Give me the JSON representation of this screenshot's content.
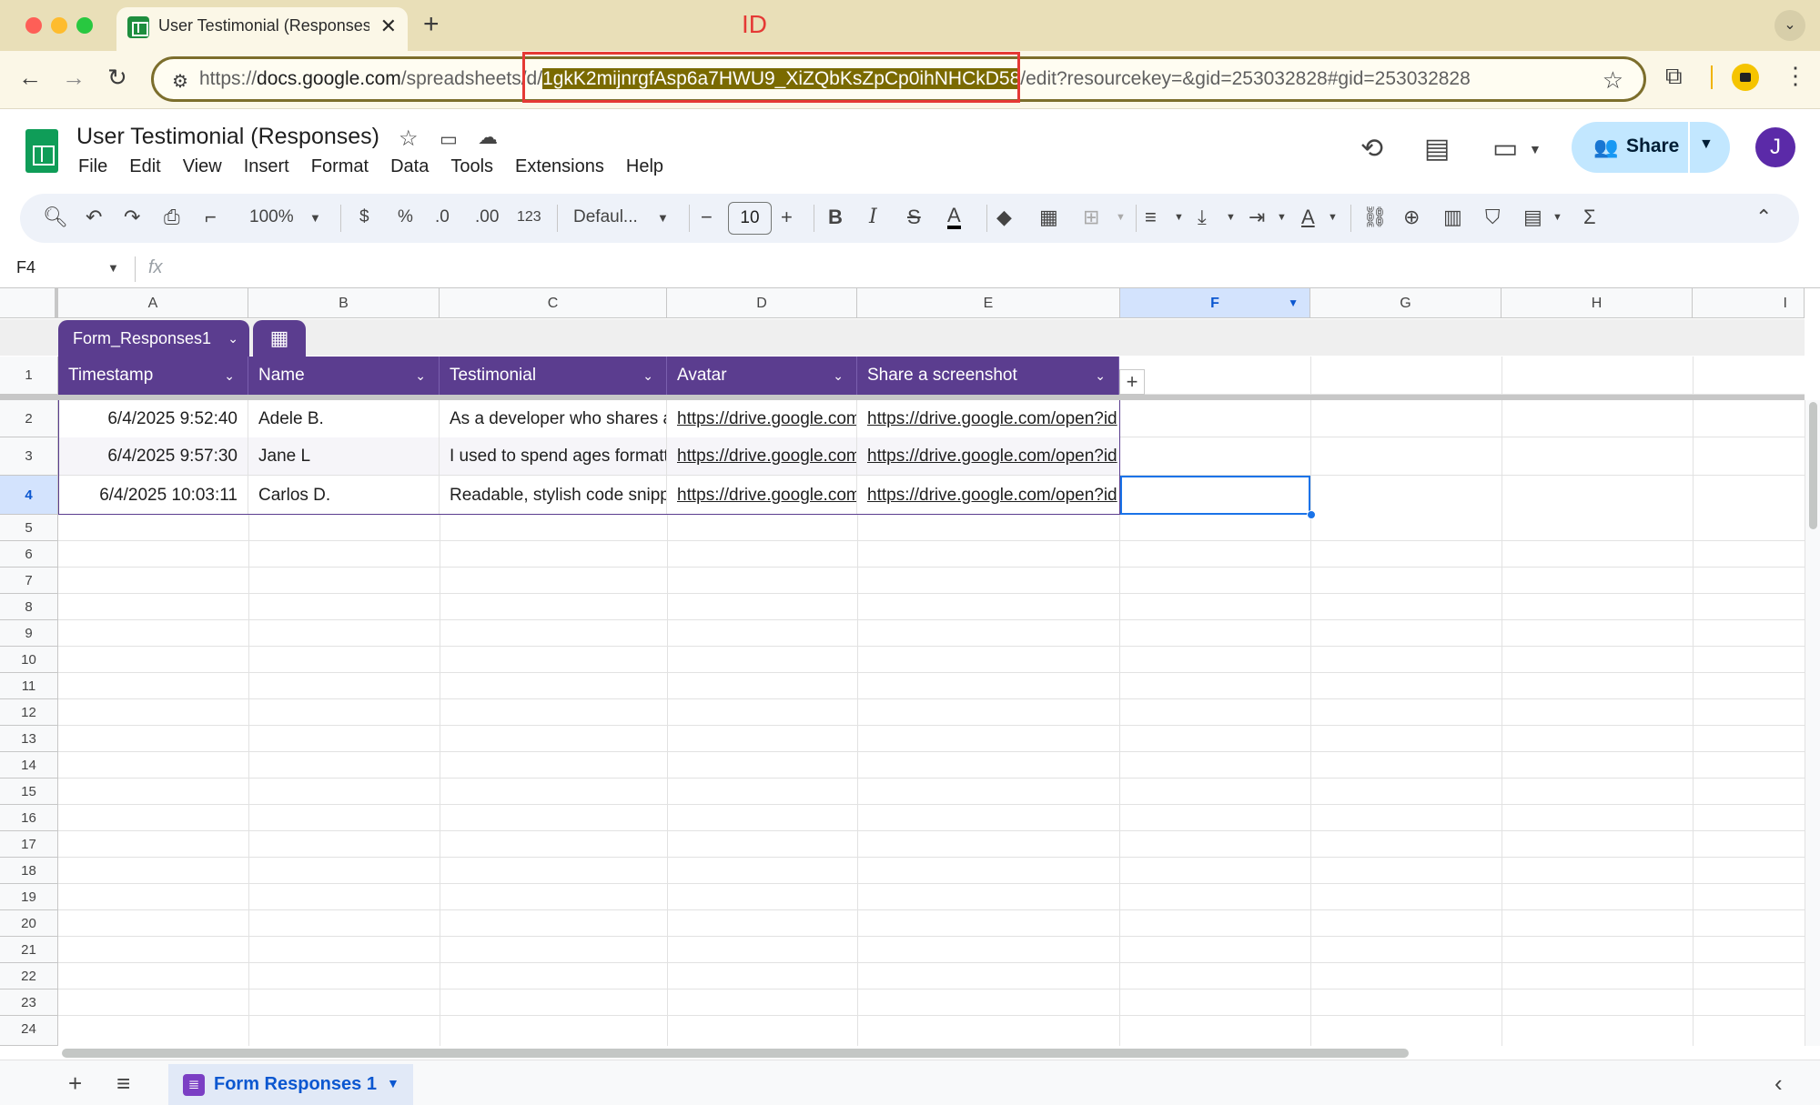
{
  "browser": {
    "tab_title": "User Testimonial (Responses)",
    "tab_close": "✕",
    "new_tab": "+",
    "tab_menu": "⌄",
    "url_prefix": "https://",
    "url_host": "docs.google.com",
    "url_path_before": "/spreadsheets/d/",
    "url_id": "1gkK2mijnrgfAsp6a7HWU9_XiZQbKsZpCp0ihNHCkD58",
    "url_path_after": "/edit?resourcekey=&gid=253032828#gid=253032828",
    "annotation_label": "ID",
    "annotation_color": "#e53935"
  },
  "sheets": {
    "doc_title": "User Testimonial (Responses)",
    "menu": [
      "File",
      "Edit",
      "View",
      "Insert",
      "Format",
      "Data",
      "Tools",
      "Extensions",
      "Help"
    ],
    "share_label": "Share",
    "avatar_letter": "J",
    "accent": "#5b3d8f"
  },
  "toolbar": {
    "zoom": "100%",
    "currency": "$",
    "percent": "%",
    "decrease_decimal": ".0",
    "increase_decimal": ".00",
    "number_format": "123",
    "font": "Defaul...",
    "font_size": "10"
  },
  "formula_bar": {
    "name_box": "F4",
    "fx": "fx"
  },
  "grid": {
    "columns": [
      "A",
      "B",
      "C",
      "D",
      "E",
      "F",
      "G",
      "H",
      "I"
    ],
    "selected_column": "F",
    "table_name": "Form_Responses1",
    "headers": [
      "Timestamp",
      "Name",
      "Testimonial",
      "Avatar",
      "Share a screenshot"
    ],
    "rows": [
      [
        "6/4/2025 9:52:40",
        "Adele B.",
        "As a developer who shares a",
        "https://drive.google.com",
        "https://drive.google.com/open?id"
      ],
      [
        "6/4/2025 9:57:30",
        "Jane L",
        "I used to spend ages formatt",
        "https://drive.google.com",
        "https://drive.google.com/open?id"
      ],
      [
        "6/4/2025 10:03:11",
        "Carlos D.",
        "Readable, stylish code snippe",
        "https://drive.google.com",
        "https://drive.google.com/open?id"
      ]
    ],
    "row_numbers": [
      "1",
      "2",
      "3",
      "4",
      "5",
      "6",
      "7",
      "8",
      "9",
      "10",
      "11",
      "12",
      "13",
      "14",
      "15",
      "16",
      "17",
      "18",
      "19",
      "20",
      "21",
      "22",
      "23",
      "24"
    ],
    "selected_row": "4"
  },
  "sheet_tabs": {
    "active": "Form Responses 1"
  }
}
